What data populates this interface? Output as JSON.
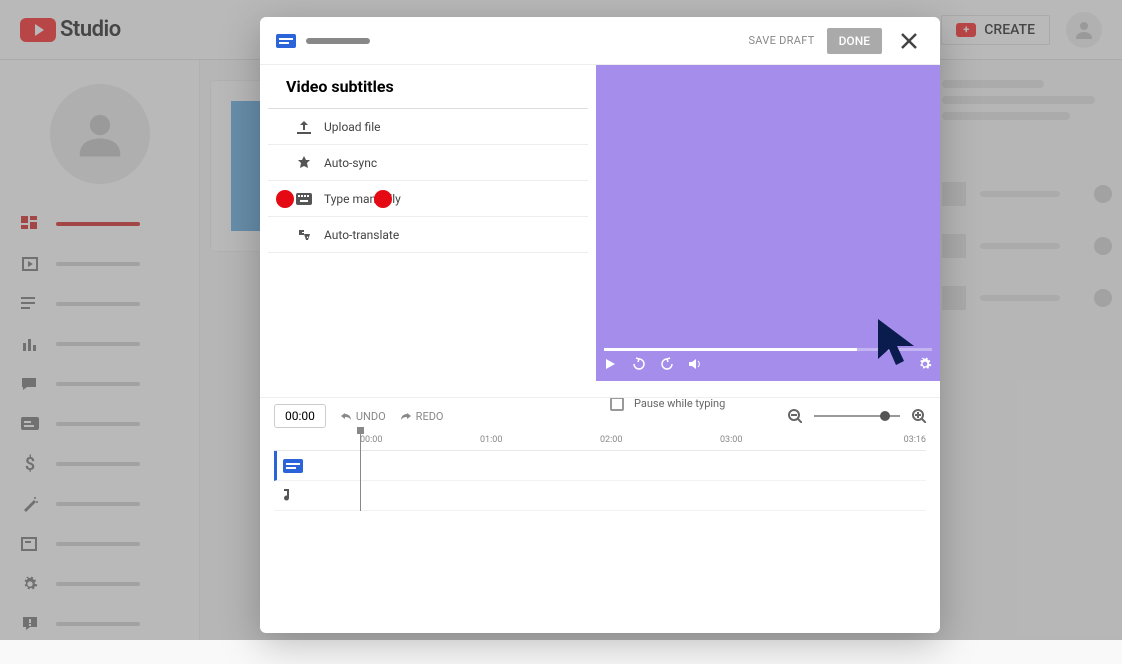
{
  "brand": "Studio",
  "create_label": "CREATE",
  "modal": {
    "save_draft": "SAVE DRAFT",
    "done": "DONE",
    "panel_title": "Video subtitles",
    "methods": {
      "upload": "Upload file",
      "autosync": "Auto-sync",
      "type_manually": "Type manually",
      "autotranslate": "Auto-translate"
    },
    "pause_while_typing": "Pause while typing",
    "timecode": "00:00",
    "undo": "UNDO",
    "redo": "REDO",
    "ruler": {
      "t0": "00:00",
      "t1": "01:00",
      "t2": "02:00",
      "t3": "03:00",
      "end": "03:16"
    }
  }
}
